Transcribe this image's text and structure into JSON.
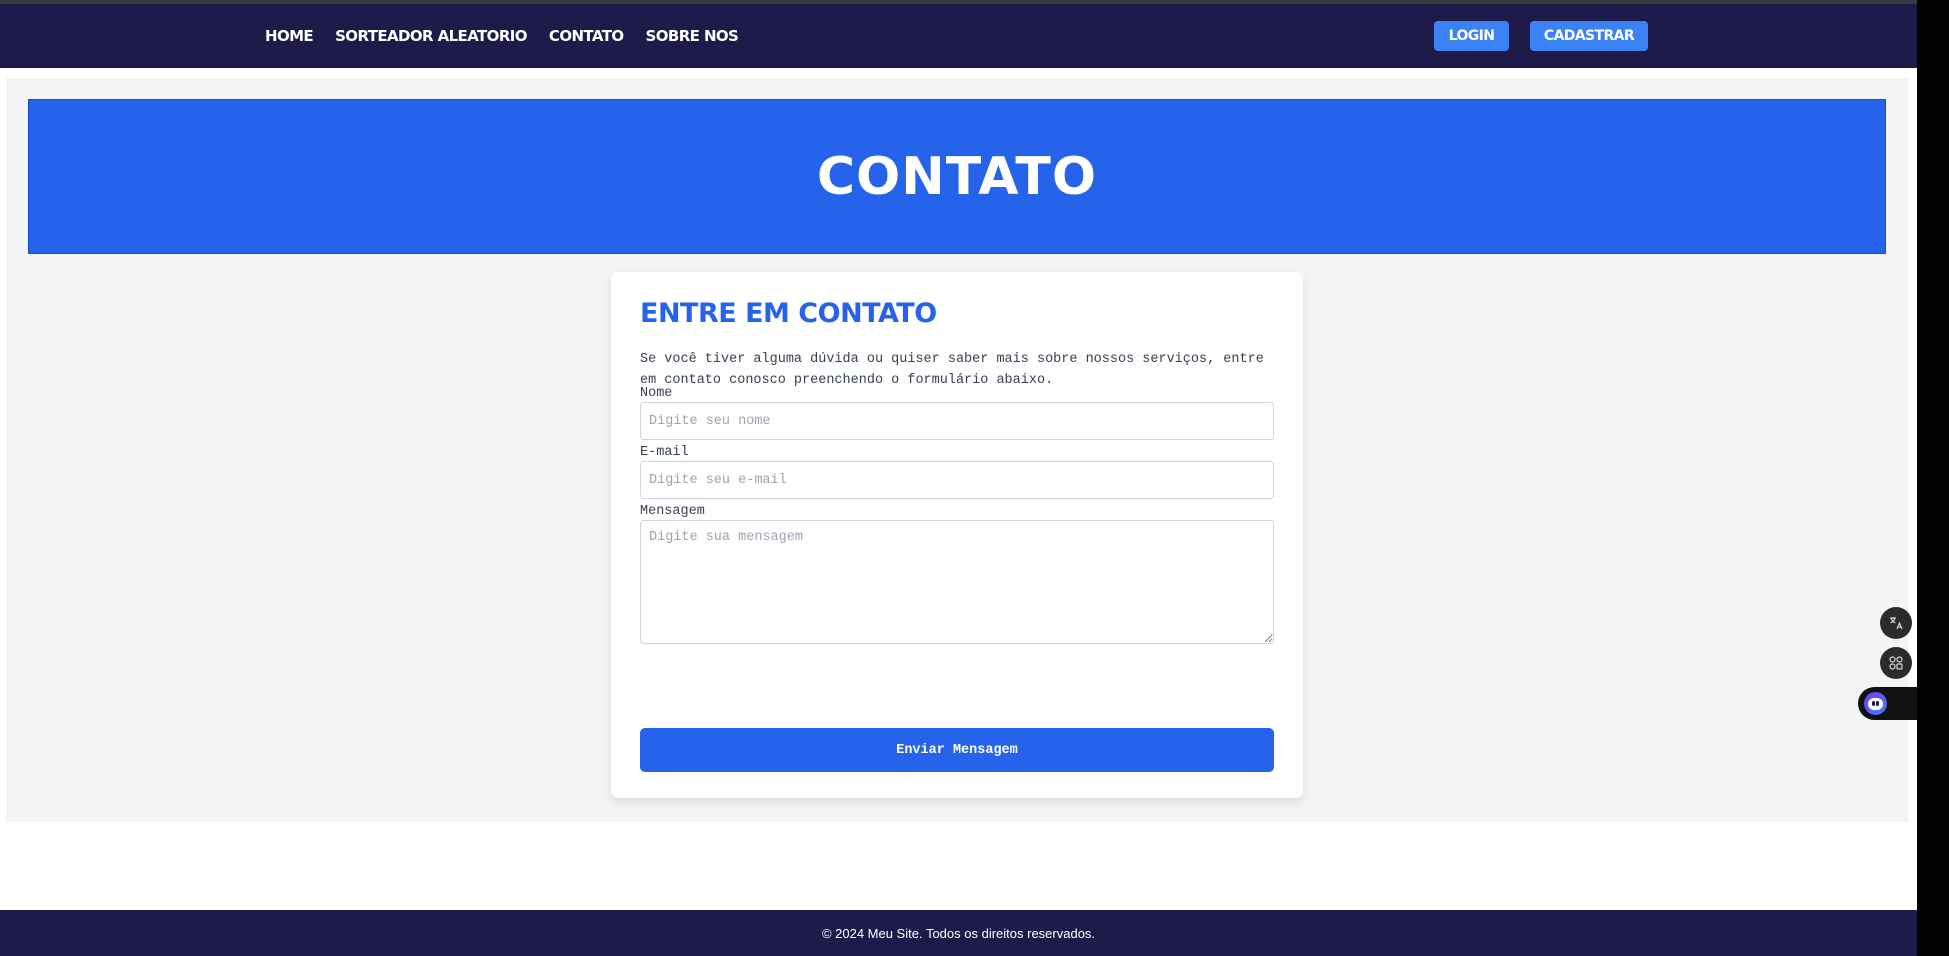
{
  "nav": {
    "links": [
      "HOME",
      "SORTEADOR ALEATORIO",
      "CONTATO",
      "SOBRE NOS"
    ],
    "login_label": "LOGIN",
    "register_label": "CADASTRAR"
  },
  "hero": {
    "title": "CONTATO"
  },
  "contact": {
    "title": "ENTRE EM CONTATO",
    "description": "Se você tiver alguma dúvida ou quiser saber mais sobre nossos serviços, entre em contato conosco preenchendo o formulário abaixo.",
    "name_label": "Nome",
    "name_placeholder": "Digite seu nome",
    "email_label": "E-mail",
    "email_placeholder": "Digite seu e-mail",
    "message_label": "Mensagem",
    "message_placeholder": "Digite sua mensagem",
    "submit_label": "Enviar Mensagem"
  },
  "footer": {
    "text": "© 2024 Meu Site. Todos os direitos reservados."
  },
  "widgets": {
    "icons": [
      "translate-icon",
      "apps-grid-icon",
      "assistant-bot-icon"
    ]
  },
  "colors": {
    "navbar": "#1e1b4b",
    "accent": "#2563eb",
    "nav_button": "#3b82f6",
    "background": "#f3f4f6"
  }
}
